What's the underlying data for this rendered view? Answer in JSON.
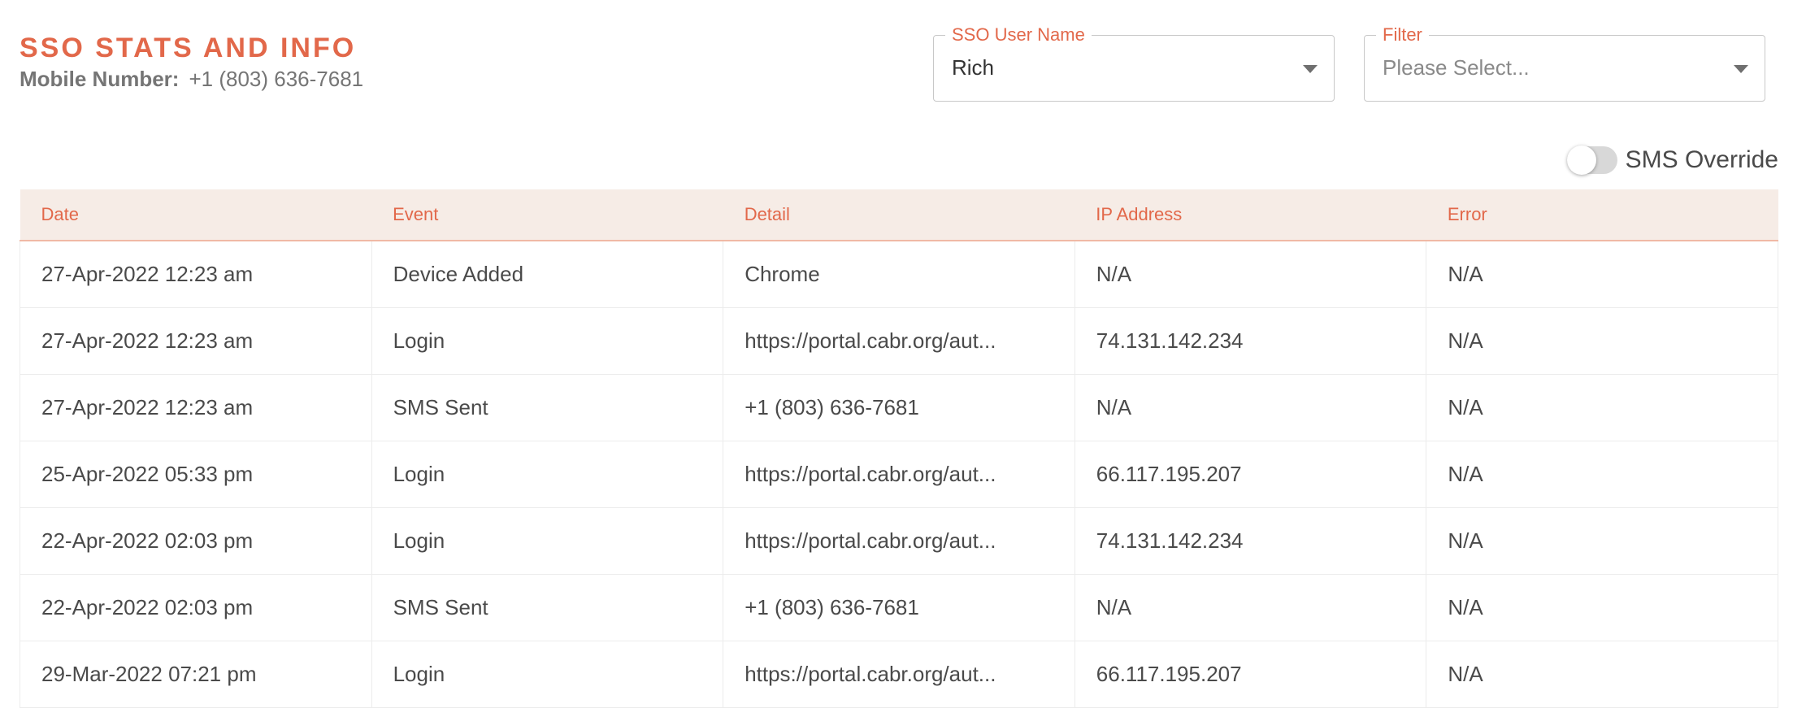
{
  "header": {
    "title": "SSO STATS AND INFO",
    "mobile_label": "Mobile Number:",
    "mobile_value": "+1 (803) 636-7681"
  },
  "sso_user": {
    "label": "SSO User Name",
    "value": "Rich"
  },
  "filter": {
    "label": "Filter",
    "placeholder": "Please Select..."
  },
  "sms_override": {
    "label": "SMS Override",
    "enabled": false
  },
  "accent_color": "#e2684a",
  "table": {
    "columns": [
      "Date",
      "Event",
      "Detail",
      "IP Address",
      "Error"
    ],
    "rows": [
      [
        "27-Apr-2022 12:23 am",
        "Device Added",
        "Chrome",
        "N/A",
        "N/A"
      ],
      [
        "27-Apr-2022 12:23 am",
        "Login",
        "https://portal.cabr.org/aut...",
        "74.131.142.234",
        "N/A"
      ],
      [
        "27-Apr-2022 12:23 am",
        "SMS Sent",
        "+1 (803) 636-7681",
        "N/A",
        "N/A"
      ],
      [
        "25-Apr-2022 05:33 pm",
        "Login",
        "https://portal.cabr.org/aut...",
        "66.117.195.207",
        "N/A"
      ],
      [
        "22-Apr-2022 02:03 pm",
        "Login",
        "https://portal.cabr.org/aut...",
        "74.131.142.234",
        "N/A"
      ],
      [
        "22-Apr-2022 02:03 pm",
        "SMS Sent",
        "+1 (803) 636-7681",
        "N/A",
        "N/A"
      ],
      [
        "29-Mar-2022 07:21 pm",
        "Login",
        "https://portal.cabr.org/aut...",
        "66.117.195.207",
        "N/A"
      ]
    ]
  }
}
